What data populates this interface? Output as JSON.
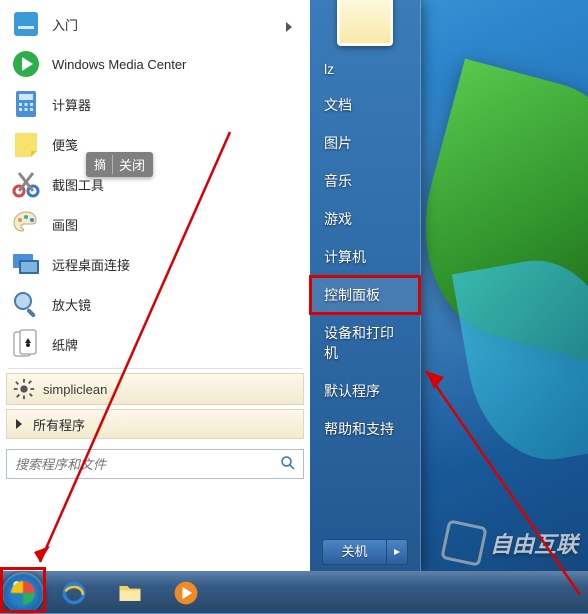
{
  "left_programs": [
    {
      "label": "入门",
      "has_submenu": true,
      "icon": "getting-started"
    },
    {
      "label": "Windows Media Center",
      "icon": "media-center"
    },
    {
      "label": "计算器",
      "icon": "calculator"
    },
    {
      "label": "便笺",
      "icon": "sticky-notes"
    },
    {
      "label": "截图工具",
      "icon": "snipping-tool"
    },
    {
      "label": "画图",
      "icon": "paint"
    },
    {
      "label": "远程桌面连接",
      "icon": "remote-desktop"
    },
    {
      "label": "放大镜",
      "icon": "magnifier"
    },
    {
      "label": "纸牌",
      "icon": "solitaire"
    }
  ],
  "special_row": {
    "label": "simpliclean"
  },
  "all_programs": {
    "label": "所有程序"
  },
  "search": {
    "placeholder": "搜索程序和文件"
  },
  "tooltip": {
    "text": "摘",
    "close": "关闭"
  },
  "right_items": [
    {
      "label": "lz"
    },
    {
      "label": "文档"
    },
    {
      "label": "图片"
    },
    {
      "label": "音乐"
    },
    {
      "label": "游戏"
    },
    {
      "label": "计算机"
    },
    {
      "label": "控制面板",
      "highlight": true
    },
    {
      "label": "设备和打印机"
    },
    {
      "label": "默认程序"
    },
    {
      "label": "帮助和支持"
    }
  ],
  "shutdown": {
    "label": "关机"
  },
  "watermark": {
    "text": "自由互联"
  },
  "taskbar_items": [
    {
      "name": "ie",
      "color": "#2b7fd4"
    },
    {
      "name": "explorer",
      "color": "#f4d06a"
    },
    {
      "name": "media-player",
      "color": "#f08a24"
    }
  ]
}
